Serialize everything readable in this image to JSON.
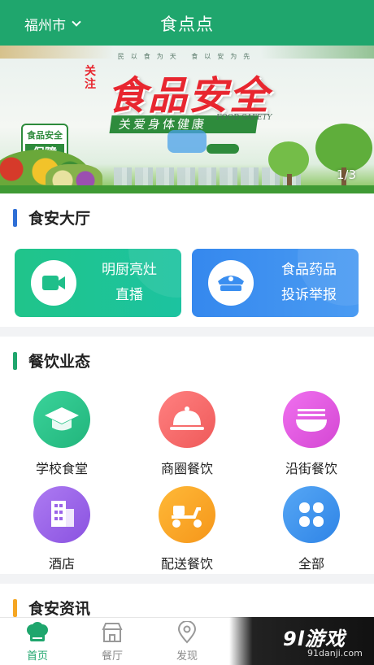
{
  "header": {
    "city": "福州市",
    "title": "食点点"
  },
  "banner": {
    "top_text": "民以食为天 食以安为先",
    "tag": "关注",
    "headline": "食品安全",
    "subtitle": "关爱身体健康",
    "en_text": "FOOD SAFETY",
    "badge_top": "食品安全",
    "badge_main": "保障",
    "page_indicator": "1/3"
  },
  "hall": {
    "title": "食安大厅",
    "cards": [
      {
        "line1": "明厨亮灶",
        "line2": "直播",
        "icon": "video-camera-icon",
        "color": "#1fbf8a"
      },
      {
        "line1": "食品药品",
        "line2": "投诉举报",
        "icon": "police-cap-icon",
        "color": "#3a8ef0"
      }
    ]
  },
  "categories": {
    "title": "餐饮业态",
    "items": [
      {
        "label": "学校食堂",
        "icon": "graduation-cap-icon",
        "color": "#2dc08a"
      },
      {
        "label": "商圈餐饮",
        "icon": "cloche-icon",
        "color": "#f26a6a"
      },
      {
        "label": "沿街餐饮",
        "icon": "noodle-bowl-icon",
        "color": "#e05adf"
      },
      {
        "label": "酒店",
        "icon": "hotel-building-icon",
        "color": "#9b63e8"
      },
      {
        "label": "配送餐饮",
        "icon": "delivery-scooter-icon",
        "color": "#f7a21b"
      },
      {
        "label": "全部",
        "icon": "clover-grid-icon",
        "color": "#3d93ee"
      }
    ]
  },
  "news": {
    "title": "食安资讯"
  },
  "tabbar": {
    "tabs": [
      {
        "label": "首页",
        "icon": "chef-hat-icon",
        "active": true
      },
      {
        "label": "餐厅",
        "icon": "storefront-icon",
        "active": false
      },
      {
        "label": "发现",
        "icon": "location-pin-icon",
        "active": false
      }
    ]
  },
  "watermark": {
    "logo": "9l游戏",
    "url": "91danji.com"
  },
  "colors": {
    "primary": "#1fa66d",
    "accent_blue": "#2f6fd6",
    "accent_green": "#1fa66d",
    "accent_orange": "#f5a623"
  }
}
